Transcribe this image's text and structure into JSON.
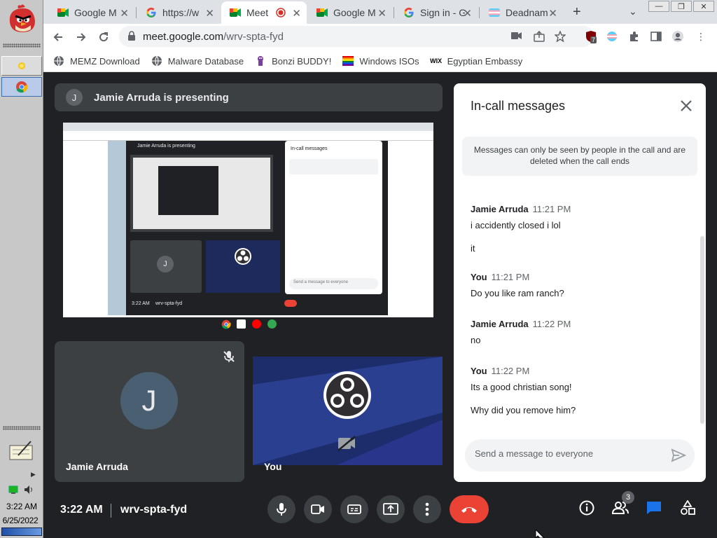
{
  "os": {
    "clock_time": "3:22 AM",
    "clock_date": "6/25/2022"
  },
  "browser": {
    "tabs": [
      {
        "title": "Google M",
        "icon": "google-meet-icon",
        "active": false
      },
      {
        "title": "https://w",
        "icon": "google-icon",
        "active": false
      },
      {
        "title": "Meet",
        "icon": "google-meet-icon",
        "active": true
      },
      {
        "title": "Google M",
        "icon": "google-meet-icon",
        "active": false
      },
      {
        "title": "Sign in - G",
        "icon": "google-icon",
        "active": false
      },
      {
        "title": "Deadnam",
        "icon": "trans-flag-icon",
        "active": false
      }
    ],
    "url_host": "meet.google.com",
    "url_path": "/wrv-spta-fyd",
    "extension_badge": "7",
    "bookmarks": [
      {
        "label": "MEMZ Download",
        "icon": "globe-icon"
      },
      {
        "label": "Malware Database",
        "icon": "globe-icon"
      },
      {
        "label": "Bonzi BUDDY!",
        "icon": "bonzi-icon"
      },
      {
        "label": "Windows ISOs",
        "icon": "rainbow-flag-icon"
      },
      {
        "label": "Egyptian Embassy",
        "icon": "wix-icon"
      }
    ]
  },
  "meet": {
    "presenter_initial": "J",
    "presenting_text": "Jamie Arruda is presenting",
    "screen_share": {
      "presenting_text": "Jamie Arruda is presenting",
      "chat_title": "In-call messages",
      "time": "3:22 AM",
      "code": "wrv-spta-fyd",
      "input_placeholder": "Send a message to everyone"
    },
    "tiles": [
      {
        "name": "Jamie Arruda",
        "initial": "J",
        "muted": true
      },
      {
        "name": "You",
        "initial": "",
        "camera_off": true
      }
    ],
    "chat": {
      "title": "In-call messages",
      "notice": "Messages can only be seen by people in the call and are deleted when the call ends",
      "messages": [
        {
          "sender": "Jamie Arruda",
          "time": "11:21 PM",
          "lines": [
            "i accidently closed i lol",
            "it"
          ]
        },
        {
          "sender": "You",
          "time": "11:21 PM",
          "lines": [
            "Do you like ram ranch?"
          ]
        },
        {
          "sender": "Jamie Arruda",
          "time": "11:22 PM",
          "lines": [
            "no"
          ]
        },
        {
          "sender": "You",
          "time": "11:22 PM",
          "lines": [
            "Its a good christian song!",
            "Why did you remove him?"
          ]
        }
      ],
      "input_placeholder": "Send a message to everyone"
    },
    "bottom": {
      "time": "3:22 AM",
      "meeting_code": "wrv-spta-fyd",
      "people_count": "3"
    },
    "colors": {
      "end_call": "#ea4335",
      "chat_active": "#1a73e8",
      "background": "#202124",
      "tile": "#3c4043"
    }
  }
}
